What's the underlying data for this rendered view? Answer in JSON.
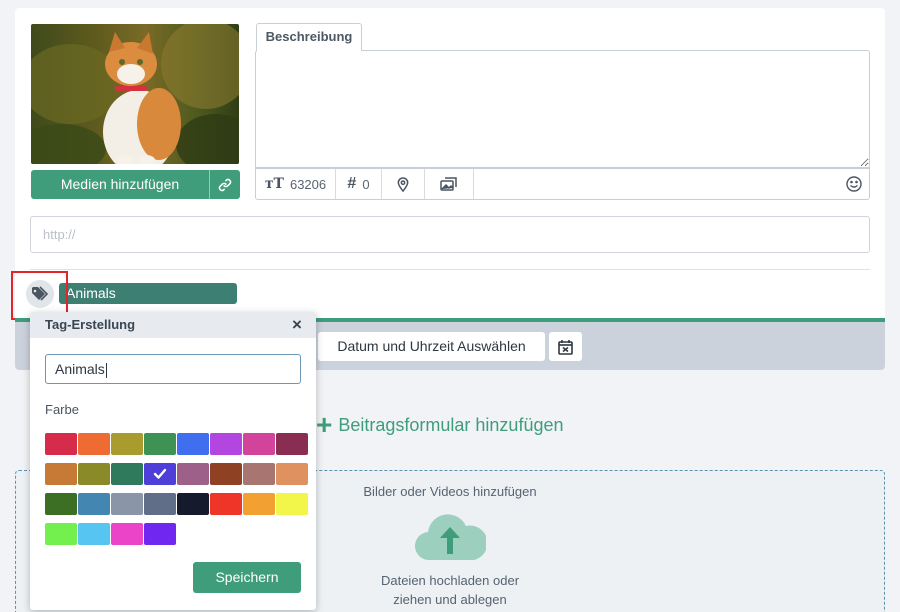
{
  "media": {
    "add_label": "Medien hinzufügen"
  },
  "description": {
    "tab_label": "Beschreibung",
    "text": "",
    "char_count": "63206",
    "hashtag_count": "0"
  },
  "url_input": {
    "placeholder": "http://"
  },
  "tag": {
    "chip_label": "Animals"
  },
  "schedule": {
    "date_button_label": "Datum und Uhrzeit Auswählen"
  },
  "add_form_label": "Beitragsformular hinzufügen",
  "upload": {
    "title": "Bilder oder Videos hinzufügen",
    "text_line1": "Dateien hochladen oder",
    "text_line2": "ziehen und ablegen"
  },
  "tag_popup": {
    "title": "Tag-Erstellung",
    "close_symbol": "×",
    "name_value": "Animals",
    "color_label": "Farbe",
    "save_label": "Speichern",
    "selected_color_index": 11,
    "colors": [
      "#d72b4b",
      "#ef6b34",
      "#a89c2f",
      "#3e9253",
      "#3f6eef",
      "#b345e0",
      "#d2449b",
      "#8a2d52",
      "#c77a35",
      "#8a8a28",
      "#2f7a5c",
      "#4e3fd8",
      "#9c6089",
      "#8e4223",
      "#a87570",
      "#e09160",
      "#3c6e23",
      "#4486b2",
      "#8b95a8",
      "#606e87",
      "#151a2c",
      "#ef3527",
      "#f3a033",
      "#f2f64a",
      "#74f04e",
      "#57c5f2",
      "#eb44c9",
      "#7028f0"
    ]
  }
}
